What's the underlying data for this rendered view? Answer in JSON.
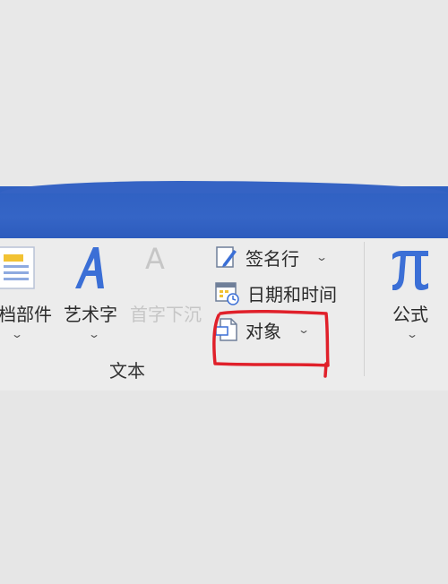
{
  "ribbon": {
    "doc_parts_label": "档部件",
    "word_art_label": "艺术字",
    "drop_cap_label": "首字下沉",
    "drop_cap_letter": "A",
    "signature_line_label": "签名行",
    "datetime_label": "日期和时间",
    "object_label": "对象",
    "group_text_label": "文本",
    "formula_label": "公式",
    "chevron": "⌄"
  },
  "colors": {
    "accent_blue": "#2f60c2",
    "icon_blue": "#3b6fd6",
    "annotation_red": "#e0202a"
  }
}
